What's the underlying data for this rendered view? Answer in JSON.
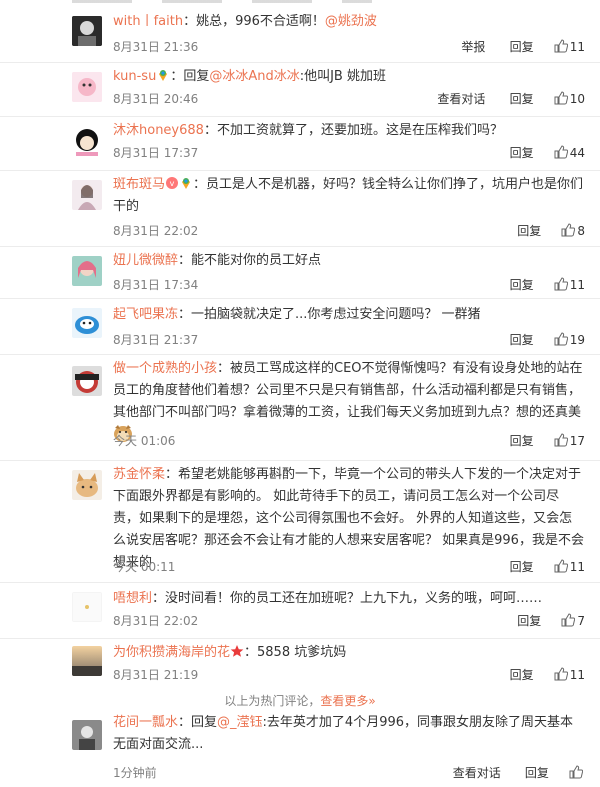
{
  "comments": [
    {
      "user": "with丨faith",
      "text": "：姚总，996不合适啊！",
      "mention": "@姚劲波",
      "time": "8月31日 21:36",
      "actions": [
        "举报",
        "回复"
      ],
      "likes": "11"
    },
    {
      "user": "kun-su",
      "reply_prefix": "：回复",
      "mention": "@冰冰And冰冰",
      "text": ":他叫JB 姚加班",
      "time": "8月31日 20:46",
      "actions": [
        "查看对话",
        "回复"
      ],
      "likes": "10"
    },
    {
      "user": "沐沐honey688",
      "text": "：不加工资就算了，还要加班。这是在压榨我们吗？",
      "time": "8月31日 17:37",
      "actions": [
        "回复"
      ],
      "likes": "44"
    },
    {
      "user": "斑布斑马",
      "text": "：员工是人不是机器，好吗？钱全特么让你们挣了，坑用户也是你们干的",
      "time": "8月31日 22:02",
      "actions": [
        "回复"
      ],
      "likes": "8"
    },
    {
      "user": "妞儿微微醉",
      "text": "：能不能对你的员工好点",
      "time": "8月31日 17:34",
      "actions": [
        "回复"
      ],
      "likes": "11"
    },
    {
      "user": "起飞吧果冻",
      "text": "：一拍脑袋就决定了...你考虑过安全问题吗？ 一群猪",
      "time": "8月31日 21:37",
      "actions": [
        "回复"
      ],
      "likes": "19"
    },
    {
      "user": "做一个成熟的小孩",
      "text": "：被员工骂成这样的CEO不觉得惭愧吗？有没有设身处地的站在员工的角度替他们着想？公司里不只是只有销售部，什么活动福利都是只有销售，其他部门不叫部门吗？拿着微薄的工资，让我们每天义务加班到九点？想的还真美",
      "time": "今天 01:06",
      "actions": [
        "回复"
      ],
      "likes": "17"
    },
    {
      "user": "苏金怀柔",
      "text": "：希望老姚能够再斟酌一下，毕竟一个公司的带头人下发的一个决定对于下面跟外界都是有影响的。 如此苛待手下的员工，请问员工怎么对一个公司尽责，如果剩下的是埋怨，这个公司得氛围也不会好。 外界的人知道这些，又会怎么说安居客呢？那还会不会让有才能的人想来安居客呢？ 如果真是996，我是不会想来的",
      "time": "今天 00:11",
      "actions": [
        "回复"
      ],
      "likes": "11"
    },
    {
      "user": "唔想利",
      "text": "：没时间看！你的员工还在加班呢？上九下九，义务的哦，呵呵……",
      "time": "8月31日 22:02",
      "actions": [
        "回复"
      ],
      "likes": "7"
    },
    {
      "user": "为你积攒满海岸的花",
      "text": "：5858 坑爹坑妈",
      "time": "8月31日 21:19",
      "actions": [
        "回复"
      ],
      "likes": "11"
    },
    {
      "user": "花间一瓢水",
      "reply_prefix": "：回复",
      "mention": "@_滢钰",
      "text": ":去年英才加了4个月996，同事跟女朋友除了周天基本无面对面交流...",
      "time": "1分钟前",
      "actions": [
        "查看对话",
        "回复"
      ],
      "likes": ""
    }
  ],
  "hot_footer": {
    "text": "以上为热门评论，",
    "more": "查看更多»"
  }
}
